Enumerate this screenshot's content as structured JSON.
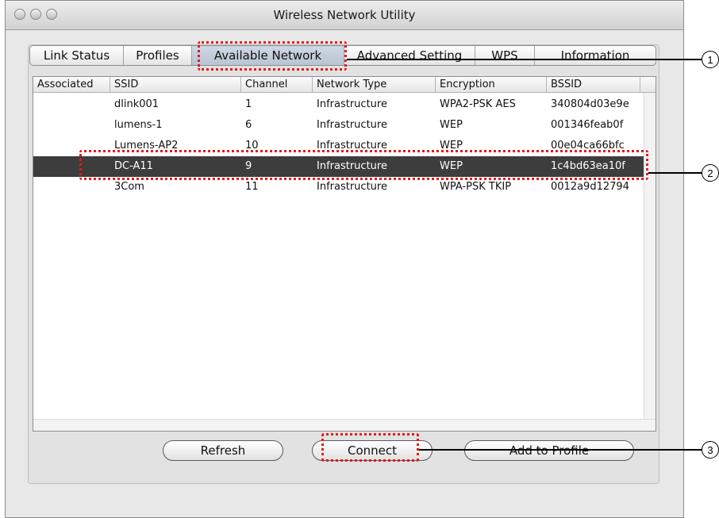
{
  "window": {
    "title": "Wireless Network Utility"
  },
  "tabs": [
    {
      "label": "Link Status"
    },
    {
      "label": "Profiles"
    },
    {
      "label": "Available Network"
    },
    {
      "label": "Advanced Setting"
    },
    {
      "label": "WPS"
    },
    {
      "label": "Information"
    }
  ],
  "active_tab": "Available Network",
  "table": {
    "columns": [
      "Associated",
      "SSID",
      "Channel",
      "Network Type",
      "Encryption",
      "BSSID"
    ],
    "rows": [
      {
        "associated": "",
        "ssid": "dlink001",
        "channel": "1",
        "network_type": "Infrastructure",
        "encryption": "WPA2-PSK AES",
        "bssid": "340804d03e9e"
      },
      {
        "associated": "",
        "ssid": "lumens-1",
        "channel": "6",
        "network_type": "Infrastructure",
        "encryption": "WEP",
        "bssid": "001346feab0f"
      },
      {
        "associated": "",
        "ssid": "Lumens-AP2",
        "channel": "10",
        "network_type": "Infrastructure",
        "encryption": "WEP",
        "bssid": "00e04ca66bfc"
      },
      {
        "associated": "",
        "ssid": "DC-A11",
        "channel": "9",
        "network_type": "Infrastructure",
        "encryption": "WEP",
        "bssid": "1c4bd63ea10f"
      },
      {
        "associated": "",
        "ssid": "3Com",
        "channel": "11",
        "network_type": "Infrastructure",
        "encryption": "WPA-PSK TKIP",
        "bssid": "0012a9d12794"
      }
    ],
    "selected_ssid": "DC-A11"
  },
  "buttons": {
    "refresh": "Refresh",
    "connect": "Connect",
    "add_to_profile": "Add to Profile"
  },
  "callouts": [
    "1",
    "2",
    "3"
  ],
  "colors": {
    "callout_border": "#e21c1c",
    "selected_row": "#3d3d3d"
  }
}
